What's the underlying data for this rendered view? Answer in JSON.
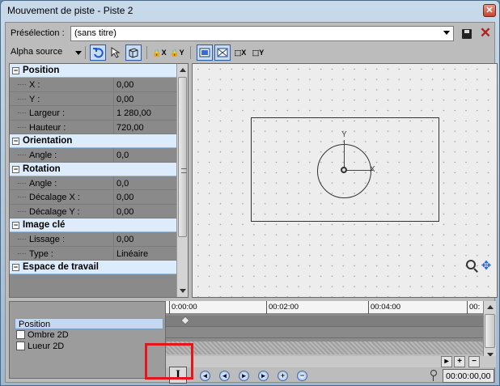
{
  "window": {
    "title": "Mouvement de piste - Piste 2",
    "close_glyph": "✕"
  },
  "preset": {
    "label": "Présélection :",
    "value": "(sans titre)"
  },
  "toolbar": {
    "alpha_label": "Alpha source"
  },
  "properties": {
    "position": {
      "label": "Position",
      "rows": [
        {
          "key": "X :",
          "value": "0,00"
        },
        {
          "key": "Y :",
          "value": "0,00"
        },
        {
          "key": "Largeur :",
          "value": "1 280,00"
        },
        {
          "key": "Hauteur :",
          "value": "720,00"
        }
      ]
    },
    "orientation": {
      "label": "Orientation",
      "rows": [
        {
          "key": "Angle :",
          "value": "0,0"
        }
      ]
    },
    "rotation": {
      "label": "Rotation",
      "rows": [
        {
          "key": "Angle :",
          "value": "0,0"
        },
        {
          "key": "Décalage X :",
          "value": "0,00"
        },
        {
          "key": "Décalage Y :",
          "value": "0,00"
        }
      ]
    },
    "keyframe": {
      "label": "Image clé",
      "rows": [
        {
          "key": "Lissage :",
          "value": "0,00"
        },
        {
          "key": "Type :",
          "value": "Linéaire"
        }
      ]
    },
    "workspace": {
      "label": "Espace de travail"
    }
  },
  "canvas": {
    "y_axis": "Y",
    "x_axis": "X"
  },
  "tracks": [
    {
      "label": "Position"
    },
    {
      "label": "Ombre 2D"
    },
    {
      "label": "Lueur 2D"
    }
  ],
  "timeline": {
    "ticks": [
      "0:00:00",
      "00:02:00",
      "00:04:00",
      "00:"
    ],
    "time_value": "00:00:00,00"
  }
}
